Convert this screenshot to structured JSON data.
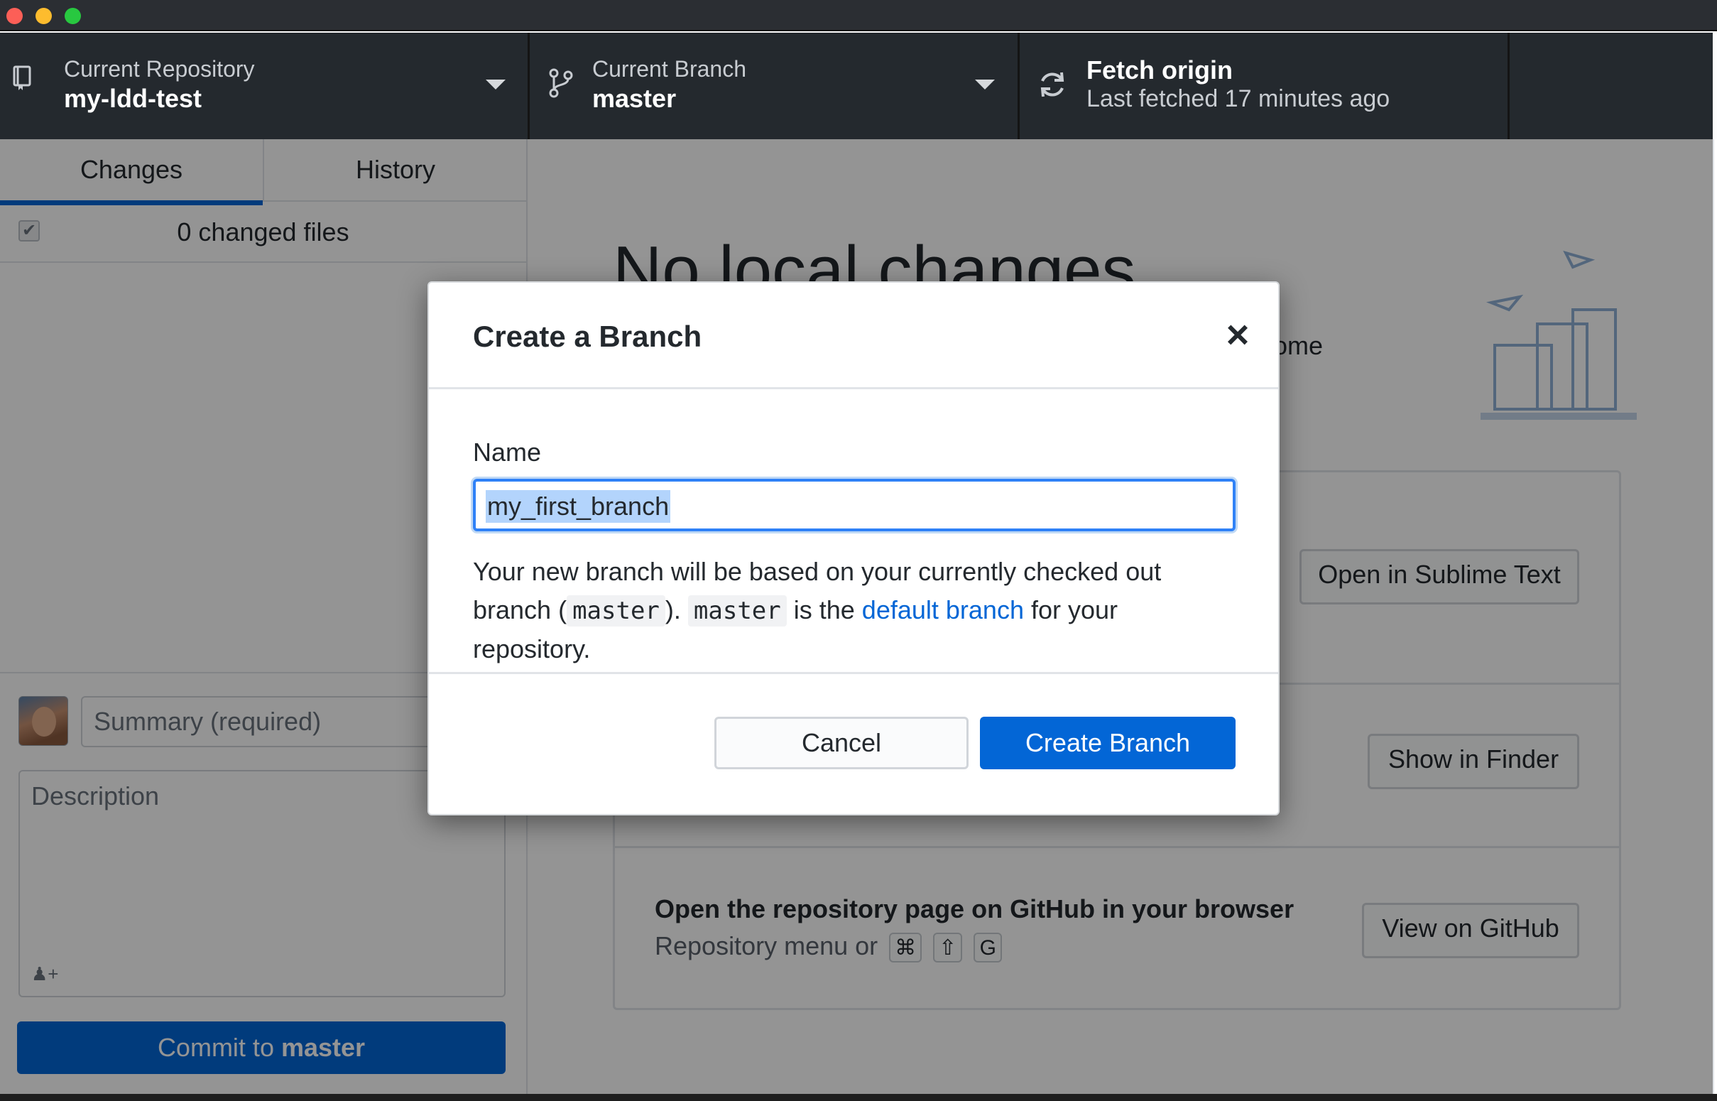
{
  "toolbar": {
    "repository": {
      "title": "Current Repository",
      "value": "my-ldd-test"
    },
    "branch": {
      "title": "Current Branch",
      "value": "master"
    },
    "fetch": {
      "title": "Fetch origin",
      "subtitle": "Last fetched 17 minutes ago"
    }
  },
  "sidebar": {
    "tabs": [
      {
        "label": "Changes",
        "selected": true
      },
      {
        "label": "History",
        "selected": false
      }
    ],
    "changed_files": "0 changed files",
    "summary_placeholder": "Summary (required)",
    "description_placeholder": "Description",
    "commit_button": {
      "prefix": "Commit to",
      "branch": "master"
    }
  },
  "main": {
    "title": "No local changes",
    "description_fragment": "e some",
    "actions": {
      "open_editor_button": "Open in Sublime Text",
      "show_finder_button": "Show in Finder",
      "github": {
        "title": "Open the repository page on GitHub in your browser",
        "hint": "Repository menu or",
        "keys": [
          "⌘",
          "⇧",
          "G"
        ],
        "button": "View on GitHub"
      }
    }
  },
  "dialog": {
    "title": "Create a Branch",
    "close_icon": "×",
    "name_label": "Name",
    "name_value": "my_first_branch",
    "helper": {
      "part1": "Your new branch will be based on your currently checked out branch (",
      "code1": "master",
      "part2": "). ",
      "code2": "master",
      "part3": " is the ",
      "link": "default branch",
      "part4": " for your repository."
    },
    "cancel_button": "Cancel",
    "create_button": "Create Branch"
  },
  "colors": {
    "accent": "#0366d6",
    "toolbar_bg": "#24292e",
    "traffic_close": "#fc5f57",
    "traffic_min": "#fdbc2e",
    "traffic_max": "#28c840"
  }
}
